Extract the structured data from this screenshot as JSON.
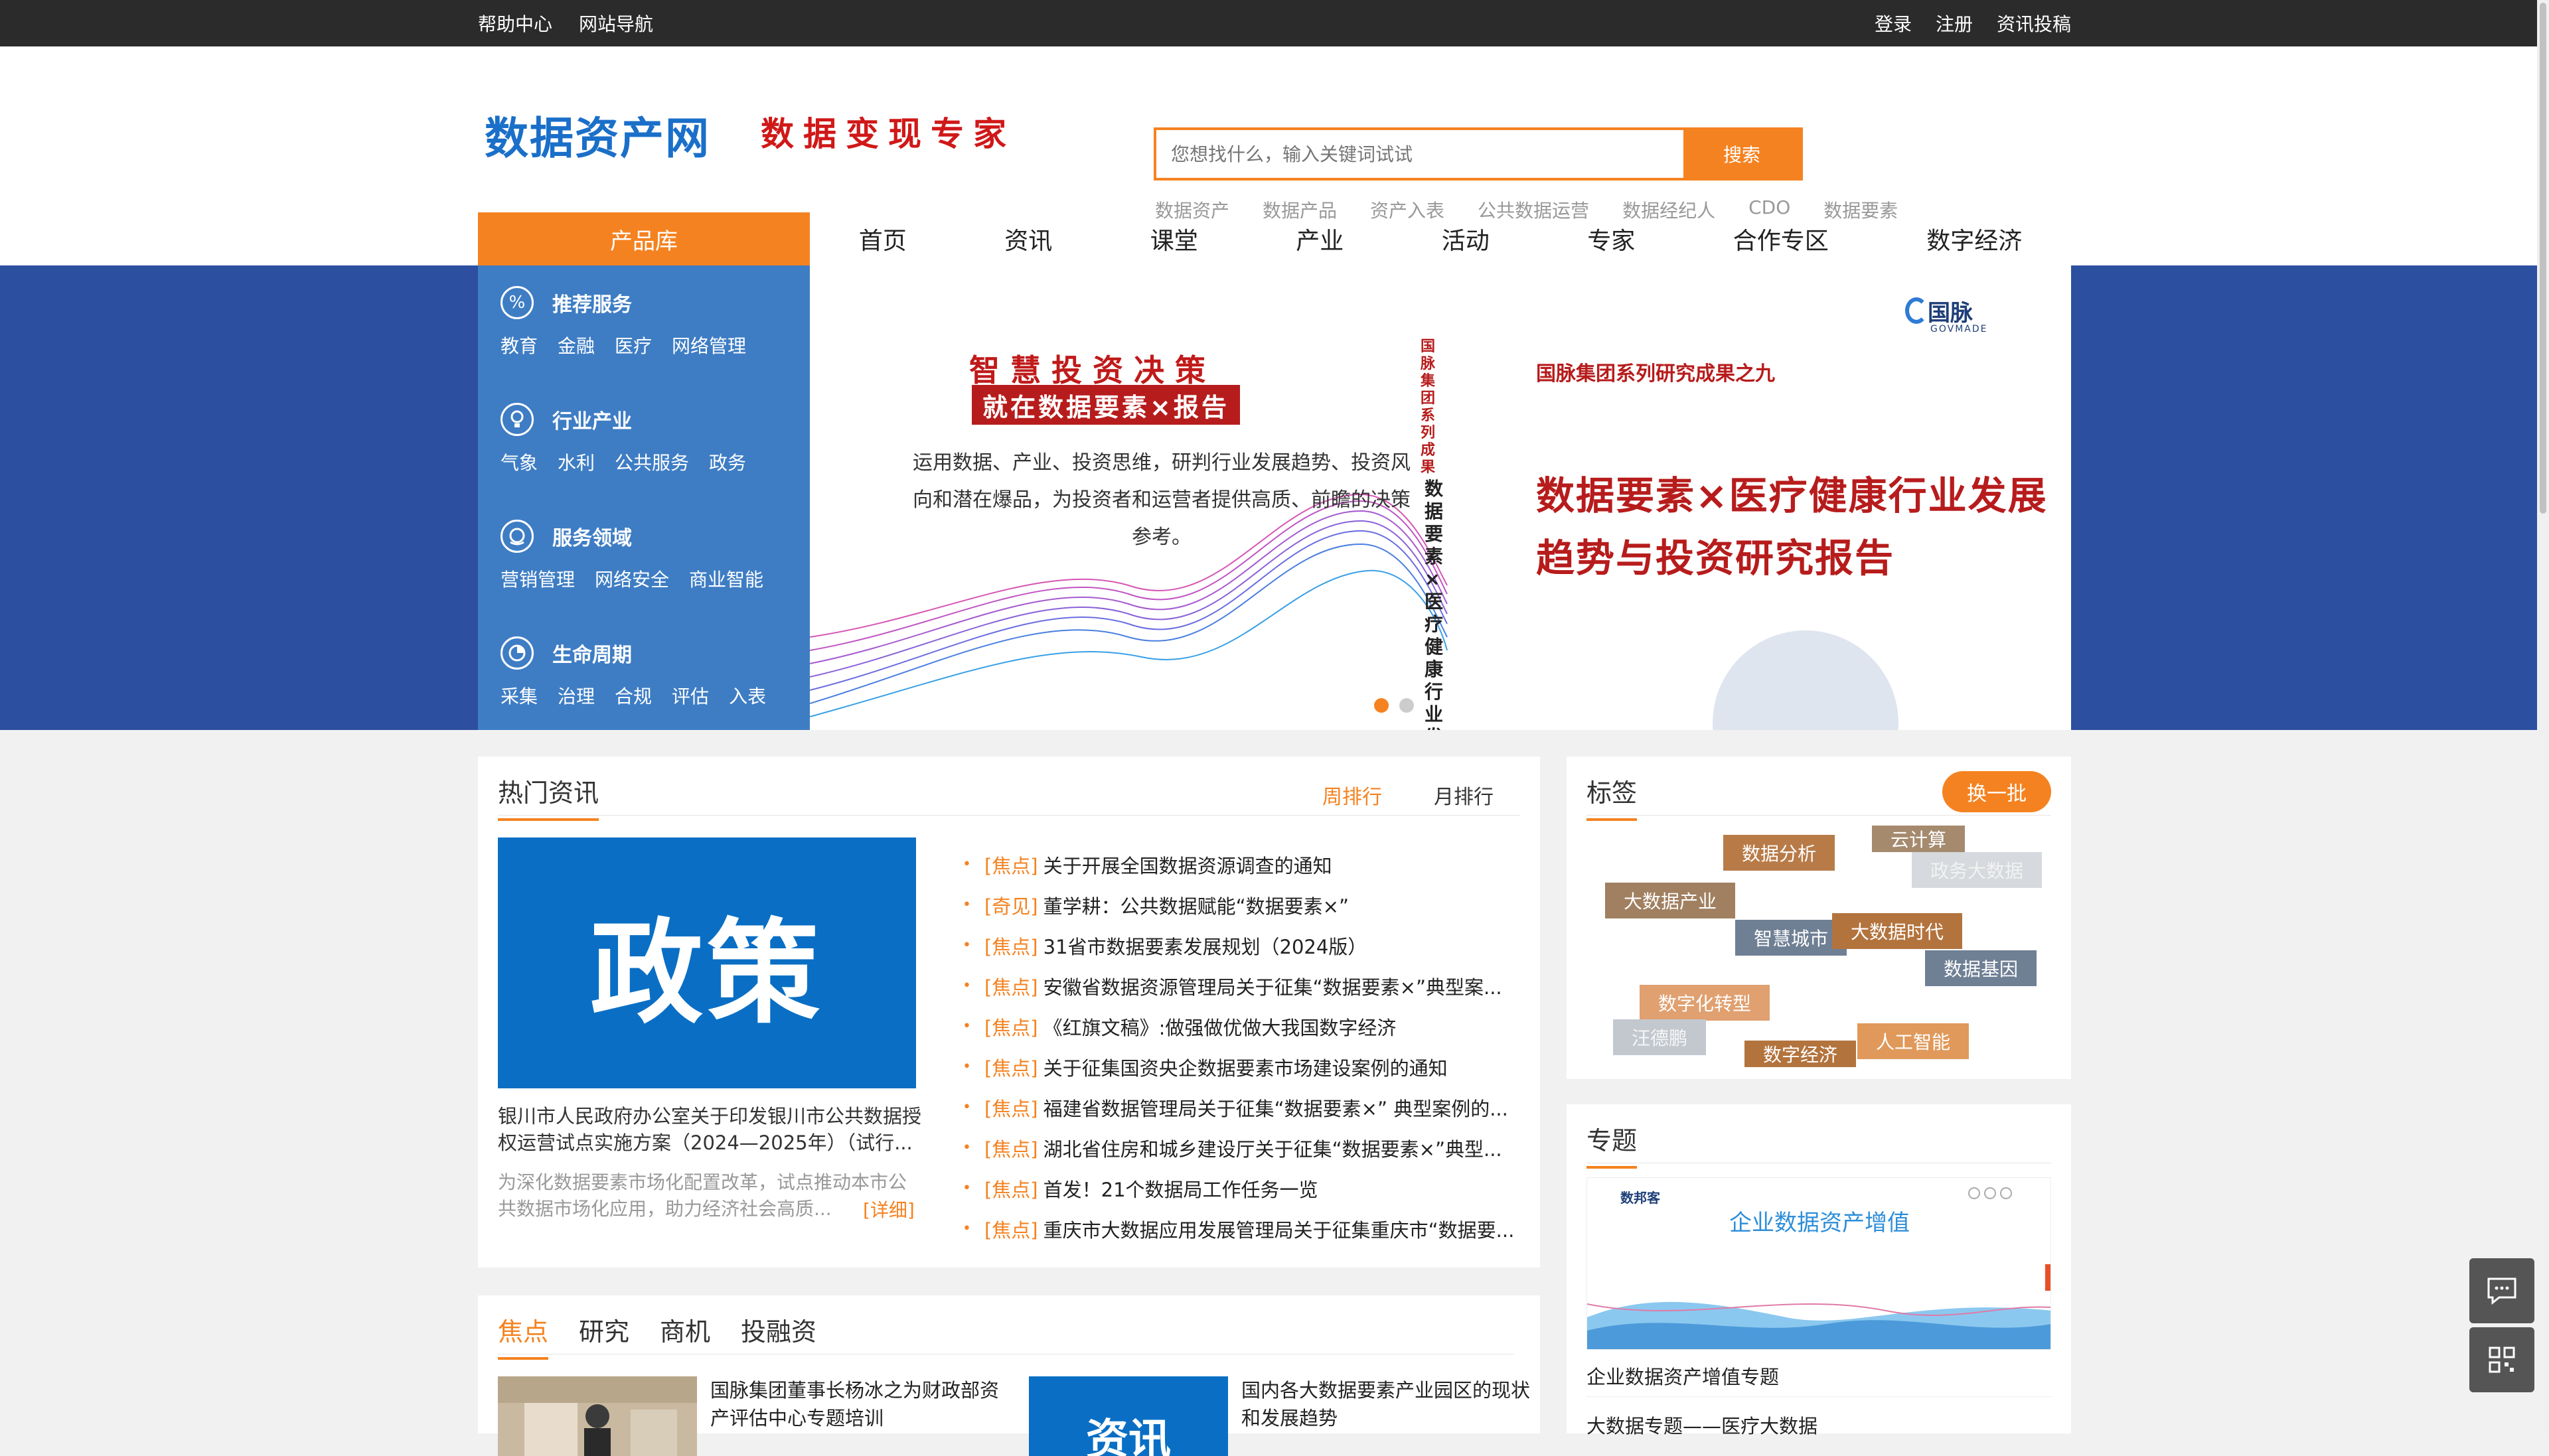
{
  "topbar": {
    "left": [
      "帮助中心",
      "网站导航"
    ],
    "right": [
      "登录",
      "注册",
      "资讯投稿"
    ]
  },
  "header": {
    "logo": "数据资产网",
    "slogan": "数据变现专家",
    "search": {
      "placeholder": "您想找什么，输入关键词试试",
      "button": "搜索"
    },
    "hotwords": [
      "数据资产",
      "数据产品",
      "资产入表",
      "公共数据运营",
      "数据经纪人",
      "CDO",
      "数据要素"
    ]
  },
  "nav": {
    "product_library": "产品库",
    "items": [
      "首页",
      "资讯",
      "课堂",
      "产业",
      "活动",
      "专家",
      "合作专区",
      "数字经济"
    ]
  },
  "sidemenu": [
    {
      "icon": "percent-icon",
      "title": "推荐服务",
      "subs": [
        "教育",
        "金融",
        "医疗",
        "网络管理"
      ]
    },
    {
      "icon": "lightbulb-icon",
      "title": "行业产业",
      "subs": [
        "气象",
        "水利",
        "公共服务",
        "政务"
      ]
    },
    {
      "icon": "globe-icon",
      "title": "服务领域",
      "subs": [
        "营销管理",
        "网络安全",
        "商业智能"
      ]
    },
    {
      "icon": "pie-chart-icon",
      "title": "生命周期",
      "subs": [
        "采集",
        "治理",
        "合规",
        "评估",
        "入表"
      ]
    }
  ],
  "banner": {
    "title1": "智慧投资决策",
    "title2": "就在数据要素×报告",
    "desc": "运用数据、产业、投资思维，研判行业发展趋势、投资风向和潜在爆品，为投资者和运营者提供高质、前瞻的决策参考。",
    "vertical_red": "国脉集团系列成果",
    "vertical_black": "数据要素×医疗健康行业发",
    "series": "国脉集团系列研究成果之九",
    "big_title": "数据要素×医疗健康行业发展趋势与投资研究报告",
    "logo_name": "国脉",
    "logo_sub": "GOVMADE"
  },
  "hot": {
    "title": "热门资讯",
    "tabs": [
      "周排行",
      "月排行"
    ],
    "image_text": "政策",
    "caption": "银川市人民政府办公室关于印发银川市公共数据授权运营试点实施方案（2024—2025年）（试行...",
    "summary": "为深化数据要素市场化配置改革，试点推动本市公共数据市场化应用，助力经济社会高质...",
    "more": "[详细]",
    "items": [
      {
        "cat": "[焦点]",
        "text": "关于开展全国数据资源调查的通知"
      },
      {
        "cat": "[奇见]",
        "text": "董学耕：公共数据赋能“数据要素×”"
      },
      {
        "cat": "[焦点]",
        "text": "31省市数据要素发展规划（2024版）"
      },
      {
        "cat": "[焦点]",
        "text": "安徽省数据资源管理局关于征集“数据要素×”典型案..."
      },
      {
        "cat": "[焦点]",
        "text": "《红旗文稿》:做强做优做大我国数字经济"
      },
      {
        "cat": "[焦点]",
        "text": "关于征集国资央企数据要素市场建设案例的通知"
      },
      {
        "cat": "[焦点]",
        "text": "福建省数据管理局关于征集“数据要素×” 典型案例的..."
      },
      {
        "cat": "[焦点]",
        "text": "湖北省住房和城乡建设厅关于征集“数据要素×”典型..."
      },
      {
        "cat": "[焦点]",
        "text": "首发！21个数据局工作任务一览"
      },
      {
        "cat": "[焦点]",
        "text": "重庆市大数据应用发展管理局关于征集重庆市“数据要..."
      }
    ]
  },
  "tags": {
    "title": "标签",
    "refresh": "换一批",
    "items": [
      {
        "text": "数据分析",
        "color": "#b87b48"
      },
      {
        "text": "云计算",
        "color": "#a58a6e"
      },
      {
        "text": "政务大数据",
        "color": "#d6d9dd"
      },
      {
        "text": "大数据产业",
        "color": "#a08060"
      },
      {
        "text": "智慧城市",
        "color": "#6f7f94"
      },
      {
        "text": "大数据时代",
        "color": "#b3733d"
      },
      {
        "text": "数据基因",
        "color": "#6f7f94"
      },
      {
        "text": "数字化转型",
        "color": "#e0a070"
      },
      {
        "text": "汪德鹏",
        "color": "#c3c8cf"
      },
      {
        "text": "数字经济",
        "color": "#b3733d"
      },
      {
        "text": "人工智能",
        "color": "#e0995a"
      }
    ]
  },
  "topic": {
    "title": "专题",
    "image_brand": "数邦客",
    "image_title": "企业数据资产增值",
    "caption1": "企业数据资产增值专题",
    "caption2": "大数据专题——医疗大数据"
  },
  "focus": {
    "tabs": [
      "焦点",
      "研究",
      "商机",
      "投融资"
    ],
    "items": [
      {
        "text": "国脉集团董事长杨冰之为财政部资产评估中心专题培训"
      },
      {
        "text": "国内各大数据要素产业园区的现状和发展趋势",
        "image_text": "资讯"
      }
    ]
  },
  "colors": {
    "accent": "#f58220",
    "brand_blue": "#1a6fc9",
    "banner_band": "#2c4fa0",
    "side_menu": "#3e7dc4"
  }
}
